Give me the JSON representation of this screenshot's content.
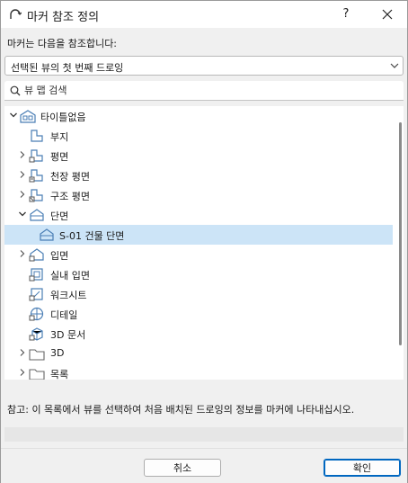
{
  "window": {
    "title": "마커 참조 정의",
    "help_label": "?"
  },
  "reference": {
    "label": "마커는 다음을 참조합니다:",
    "selected": "선택된 뷰의 첫 번째 드로잉"
  },
  "search": {
    "placeholder": "뷰 맵 검색"
  },
  "tree": {
    "items": [
      {
        "label": "타이틀없음",
        "icon": "project-icon",
        "expander": "open"
      },
      {
        "label": "부지",
        "icon": "site-plan-icon",
        "expander": "none"
      },
      {
        "label": "평면",
        "icon": "floor-plan-icon",
        "expander": "closed"
      },
      {
        "label": "천장 평면",
        "icon": "ceiling-plan-icon",
        "expander": "closed"
      },
      {
        "label": "구조 평면",
        "icon": "structural-plan-icon",
        "expander": "closed"
      },
      {
        "label": "단면",
        "icon": "section-icon",
        "expander": "open"
      },
      {
        "label": "S-01 건물 단면",
        "icon": "section-view-icon",
        "expander": "none",
        "selected": true
      },
      {
        "label": "입면",
        "icon": "elevation-icon",
        "expander": "closed"
      },
      {
        "label": "실내 입면",
        "icon": "interior-elevation-icon",
        "expander": "none"
      },
      {
        "label": "워크시트",
        "icon": "worksheet-icon",
        "expander": "none"
      },
      {
        "label": "디테일",
        "icon": "detail-icon",
        "expander": "none"
      },
      {
        "label": "3D 문서",
        "icon": "3d-document-icon",
        "expander": "none"
      },
      {
        "label": "3D",
        "icon": "folder-icon",
        "expander": "closed"
      },
      {
        "label": "목록",
        "icon": "folder-icon",
        "expander": "closed"
      }
    ]
  },
  "hint": "참고: 이 목록에서 뷰를 선택하여 처음 배치된 드로잉의 정보를 마커에 나타내십시오.",
  "buttons": {
    "cancel": "취소",
    "ok": "확인"
  },
  "colors": {
    "selection": "#cce4f7",
    "accent": "#0067c0",
    "icon_stroke": "#4a7eb5"
  }
}
